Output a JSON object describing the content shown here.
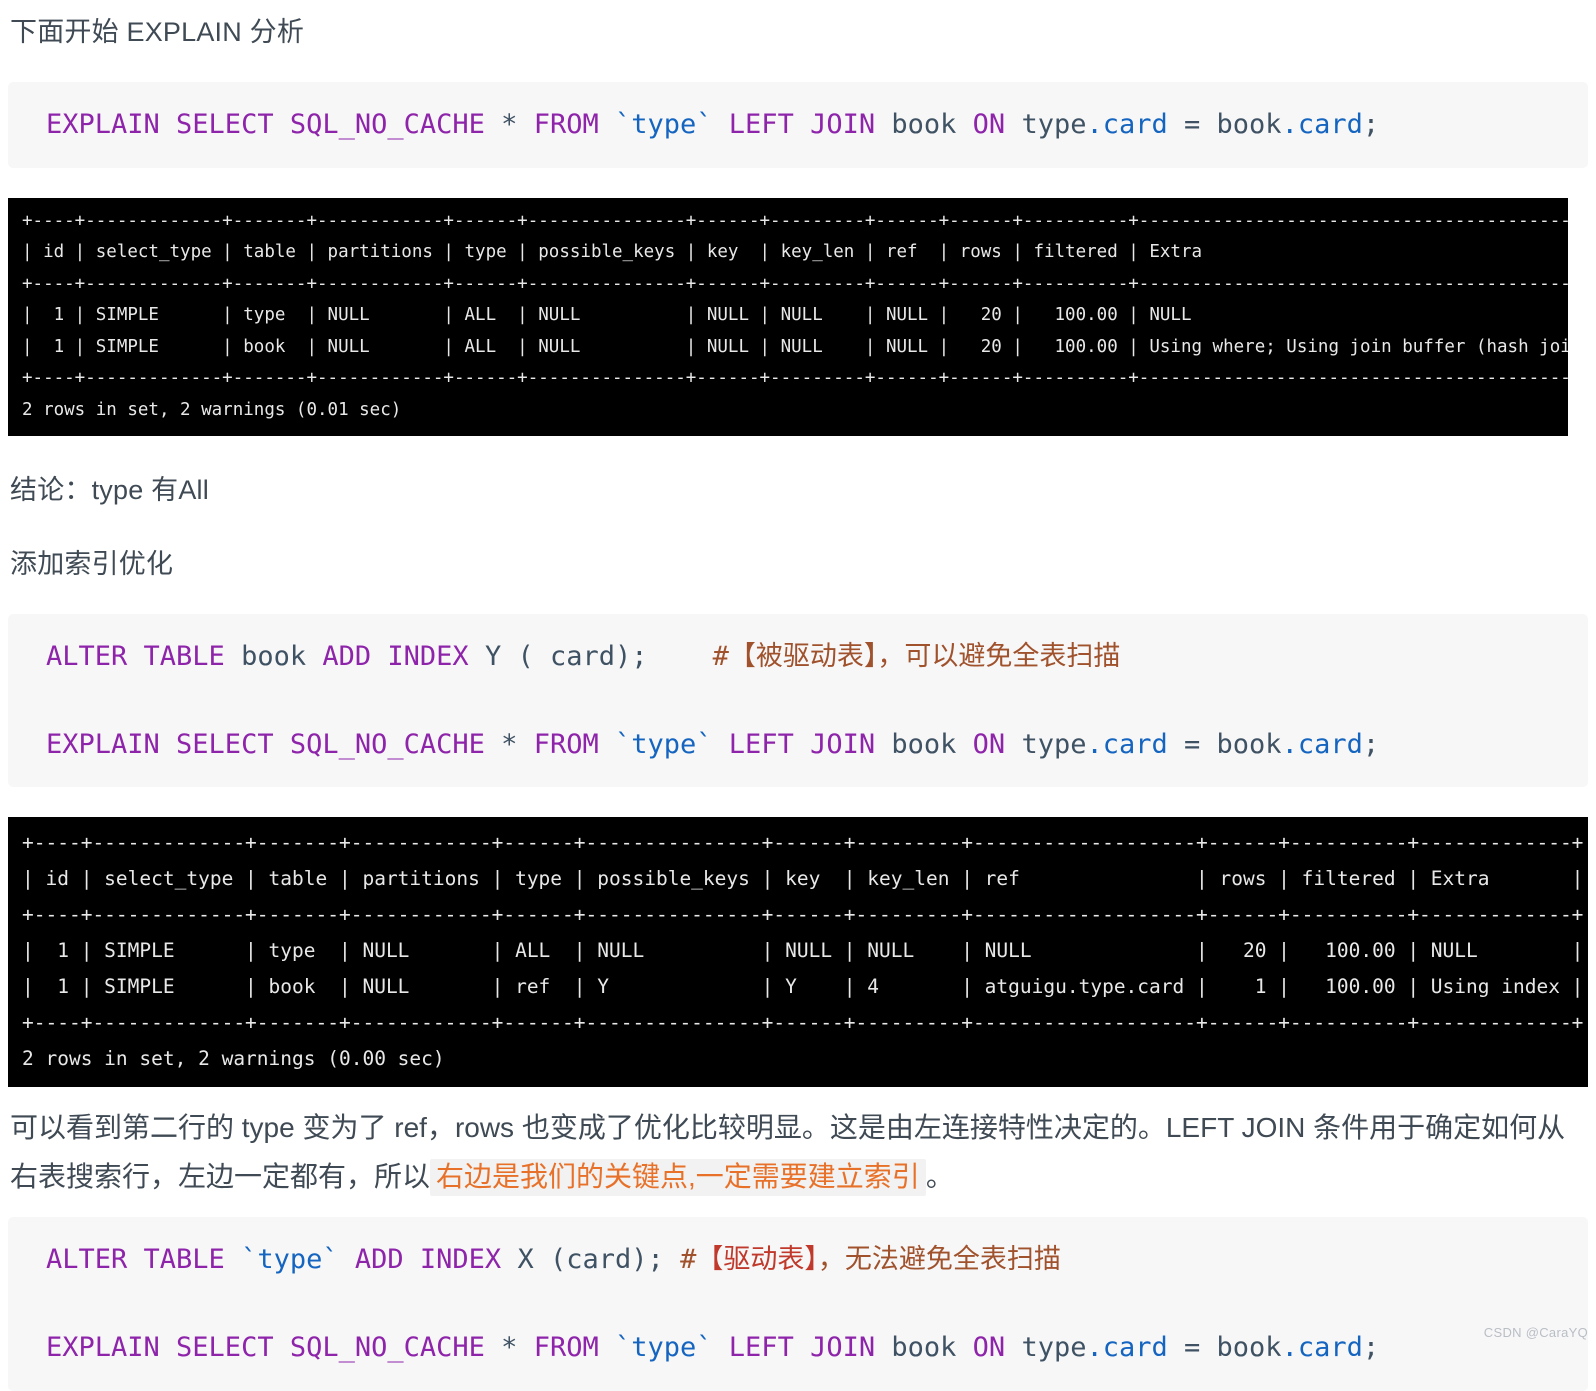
{
  "document": {
    "lead_heading": "下面开始 EXPLAIN 分析",
    "conclusion_heading": "结论：type 有All",
    "optimize_heading": "添加索引优化",
    "analysis_paragraph_part1": "可以看到第二行的 type 变为了 ref，rows 也变成了优化比较明显。这是由左连接特性决定的。LEFT JOIN 条件用于确定如何从右表搜索行，左边一定都有，所以",
    "analysis_paragraph_highlight": "右边是我们的关键点,一定需要建立索引",
    "analysis_paragraph_part2": "。"
  },
  "code_block_1": {
    "tokens": [
      {
        "t": "EXPLAIN SELECT SQL_NO_CACHE",
        "c": "kw"
      },
      {
        "t": " * ",
        "c": "op"
      },
      {
        "t": "FROM",
        "c": "kw"
      },
      {
        "t": " ",
        "c": "op"
      },
      {
        "t": "`type`",
        "c": "ident"
      },
      {
        "t": " ",
        "c": "op"
      },
      {
        "t": "LEFT JOIN",
        "c": "kw"
      },
      {
        "t": " ",
        "c": "op"
      },
      {
        "t": "book",
        "c": "tbl"
      },
      {
        "t": " ",
        "c": "op"
      },
      {
        "t": "ON",
        "c": "kw"
      },
      {
        "t": " type",
        "c": "tbl"
      },
      {
        "t": ".card",
        "c": "ident"
      },
      {
        "t": " = ",
        "c": "op"
      },
      {
        "t": "book",
        "c": "tbl"
      },
      {
        "t": ".card",
        "c": "ident"
      },
      {
        "t": ";",
        "c": "op"
      }
    ],
    "plain": "EXPLAIN SELECT SQL_NO_CACHE * FROM `type` LEFT JOIN book ON type.card = book.card;"
  },
  "code_block_2": {
    "line1_plain": "ALTER TABLE book ADD INDEX Y ( card);    #【被驱动表】，可以避免全表扫描",
    "line1_tokens": [
      {
        "t": "ALTER TABLE",
        "c": "kw"
      },
      {
        "t": " ",
        "c": "op"
      },
      {
        "t": "book",
        "c": "tbl"
      },
      {
        "t": " ",
        "c": "op"
      },
      {
        "t": "ADD INDEX",
        "c": "kw"
      },
      {
        "t": " ",
        "c": "op"
      },
      {
        "t": "Y",
        "c": "tbl"
      },
      {
        "t": " ( ",
        "c": "op"
      },
      {
        "t": "card",
        "c": "tbl"
      },
      {
        "t": ");",
        "c": "op"
      },
      {
        "t": "    #【被驱动表】，可以避免全表扫描",
        "c": "cmt"
      }
    ],
    "line2_plain": "EXPLAIN SELECT SQL_NO_CACHE * FROM `type` LEFT JOIN book ON type.card = book.card;"
  },
  "code_block_3": {
    "line1_plain": "ALTER TABLE `type` ADD INDEX X (card); #【驱动表】，无法避免全表扫描",
    "line1_tokens": [
      {
        "t": "ALTER TABLE",
        "c": "kw"
      },
      {
        "t": " ",
        "c": "op"
      },
      {
        "t": "`type`",
        "c": "ident"
      },
      {
        "t": " ",
        "c": "op"
      },
      {
        "t": "ADD INDEX",
        "c": "kw"
      },
      {
        "t": " ",
        "c": "op"
      },
      {
        "t": "X",
        "c": "tbl"
      },
      {
        "t": " (",
        "c": "op"
      },
      {
        "t": "card",
        "c": "tbl"
      },
      {
        "t": "); ",
        "c": "op"
      },
      {
        "t": "#",
        "c": "cmt"
      },
      {
        "t": "【驱动表】",
        "c": "cmt-red"
      },
      {
        "t": "，无法避免全表扫描",
        "c": "cmt"
      }
    ],
    "line2_plain": "EXPLAIN SELECT SQL_NO_CACHE * FROM `type` LEFT JOIN book ON type.card = book.card;"
  },
  "terminal_1": {
    "columns": [
      "id",
      "select_type",
      "table",
      "partitions",
      "type",
      "possible_keys",
      "key",
      "key_len",
      "ref",
      "rows",
      "filtered",
      "Extra"
    ],
    "rows": [
      {
        "id": "1",
        "select_type": "SIMPLE",
        "table": "type",
        "partitions": "NULL",
        "type": "ALL",
        "possible_keys": "NULL",
        "key": "NULL",
        "key_len": "NULL",
        "ref": "NULL",
        "rows": "20",
        "filtered": "100.00",
        "Extra": "NULL"
      },
      {
        "id": "1",
        "select_type": "SIMPLE",
        "table": "book",
        "partitions": "NULL",
        "type": "ALL",
        "possible_keys": "NULL",
        "key": "NULL",
        "key_len": "NULL",
        "ref": "NULL",
        "rows": "20",
        "filtered": "100.00",
        "Extra": "Using where; Using join buffer (hash join)"
      }
    ],
    "footer": "2 rows in set, 2 warnings (0.01 sec)",
    "text": "+----+-------------+-------+------------+------+---------------+------+---------+------+------+----------+--------------------------------------------+\n| id | select_type | table | partitions | type | possible_keys | key  | key_len | ref  | rows | filtered | Extra                                      |\n+----+-------------+-------+------------+------+---------------+------+---------+------+------+----------+--------------------------------------------+\n|  1 | SIMPLE      | type  | NULL       | ALL  | NULL          | NULL | NULL    | NULL |   20 |   100.00 | NULL                                       |\n|  1 | SIMPLE      | book  | NULL       | ALL  | NULL          | NULL | NULL    | NULL |   20 |   100.00 | Using where; Using join buffer (hash join) |\n+----+-------------+-------+------------+------+---------------+------+---------+------+------+----------+--------------------------------------------+\n2 rows in set, 2 warnings (0.01 sec)"
  },
  "terminal_2": {
    "columns": [
      "id",
      "select_type",
      "table",
      "partitions",
      "type",
      "possible_keys",
      "key",
      "key_len",
      "ref",
      "rows",
      "filtered",
      "Extra"
    ],
    "rows": [
      {
        "id": "1",
        "select_type": "SIMPLE",
        "table": "type",
        "partitions": "NULL",
        "type": "ALL",
        "possible_keys": "NULL",
        "key": "NULL",
        "key_len": "NULL",
        "ref": "NULL",
        "rows": "20",
        "filtered": "100.00",
        "Extra": "NULL"
      },
      {
        "id": "1",
        "select_type": "SIMPLE",
        "table": "book",
        "partitions": "NULL",
        "type": "ref",
        "possible_keys": "Y",
        "key": "Y",
        "key_len": "4",
        "ref": "atguigu.type.card",
        "rows": "1",
        "filtered": "100.00",
        "Extra": "Using index"
      }
    ],
    "footer": "2 rows in set, 2 warnings (0.00 sec)",
    "text": "+----+-------------+-------+------------+------+---------------+------+---------+-------------------+------+----------+-------------+\n| id | select_type | table | partitions | type | possible_keys | key  | key_len | ref               | rows | filtered | Extra       |\n+----+-------------+-------+------------+------+---------------+------+---------+-------------------+------+----------+-------------+\n|  1 | SIMPLE      | type  | NULL       | ALL  | NULL          | NULL | NULL    | NULL              |   20 |   100.00 | NULL        |\n|  1 | SIMPLE      | book  | NULL       | ref  | Y             | Y    | 4       | atguigu.type.card |    1 |   100.00 | Using index |\n+----+-------------+-------+------------+------+---------------+------+---------+-------------------+------+----------+-------------+\n2 rows in set, 2 warnings (0.00 sec)"
  },
  "watermark": {
    "text": "CSDN @CaraYQ"
  },
  "colors": {
    "keyword": "#8e24aa",
    "identifier": "#1565c0",
    "table": "#3f5263",
    "comment": "#a0522d",
    "comment_emphasis": "#c0392b",
    "highlight_text": "#e8712a",
    "highlight_bg": "#f2f2f2",
    "code_bg": "#f7f7f8",
    "terminal_bg": "#000000",
    "terminal_fg": "#e8e8e8",
    "body_text": "#3f4a54"
  }
}
